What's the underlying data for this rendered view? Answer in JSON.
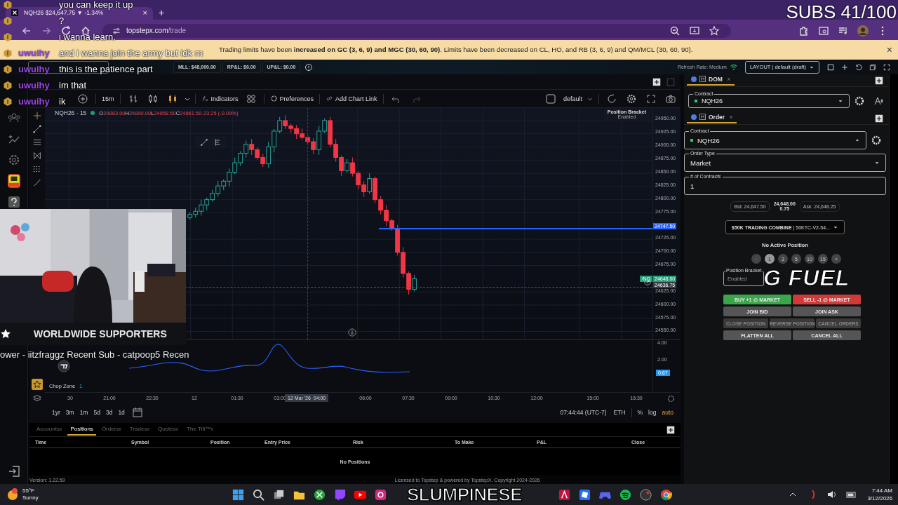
{
  "browser": {
    "tab_title": "NQH26 $24,647.75 ▼ -1.34%",
    "tab_close": "×",
    "new_tab": "+",
    "url_host": "topstepx.com",
    "url_path": "/trade"
  },
  "banner": {
    "text": "Trading limits have been **increased on GC (3, 6, 9) and MGC (30, 60, 90)**. Limits have been decreased on CL, HO, and RB (3, 6, 9) and QM/MCL (30, 60, 90).",
    "close": "×"
  },
  "app_bar": {
    "stats": [
      "MLL: $48,000.00",
      "RP&L: $0.00",
      "UP&L: $0.00"
    ],
    "refresh": "Refresh Rate: Medium",
    "layout": "LAYOUT | default (draft)"
  },
  "toolbar": {
    "interval": "15m",
    "indicators": "Indicators",
    "preferences": "Preferences",
    "chart_link": "Add Chart Link",
    "template": "default"
  },
  "legend": {
    "symbol": "NQH26 · 15",
    "ohlc": [
      {
        "label": "O",
        "value": "24883.00"
      },
      {
        "label": "H",
        "value": "24890.00"
      },
      {
        "label": "L",
        "value": "24858.50"
      },
      {
        "label": "C",
        "value": "24861.50"
      }
    ],
    "change": "-23.25 (-0.09%)"
  },
  "position_bracket_badge": {
    "title": "Position Bracket",
    "state": "Enabled"
  },
  "price_axis": [
    "24950.00",
    "24925.00",
    "24900.00",
    "24875.00",
    "24850.00",
    "24825.00",
    "24800.00",
    "24775.00",
    "24725.00",
    "24700.00",
    "24675.00",
    "24625.00",
    "24600.00",
    "24575.00",
    "24550.00"
  ],
  "price_markers": [
    {
      "kind": "line",
      "value": "24747.50",
      "color": "#2962ff"
    },
    {
      "kind": "last",
      "value": "24648.00",
      "tag": "/NQ",
      "color": "#1e9e72"
    },
    {
      "kind": "cursor",
      "value": "24636.75",
      "color": "#363a45"
    }
  ],
  "indicator": {
    "name": "Chop Zone",
    "value": "1",
    "axis": [
      "4.00",
      "2.00"
    ],
    "badge": "0.67"
  },
  "time_axis": [
    "30",
    "21:00",
    "22:30",
    "12",
    "01:30",
    "03:00",
    "06:00",
    "07:30",
    "09:00",
    "10:30",
    "12:00",
    "15:00",
    "16:30"
  ],
  "cursor_time": {
    "date": "12 Mar '26",
    "time": "04:00"
  },
  "ranges": [
    "1yr",
    "3m",
    "1m",
    "5d",
    "3d",
    "1d"
  ],
  "clock": "07:44:44 (UTC-7)",
  "session": "ETH",
  "scale_options": [
    "%",
    "log",
    "auto"
  ],
  "bottom_tabs": [
    {
      "label": "Accounts",
      "close": "x",
      "selected": false
    },
    {
      "label": "Positions",
      "selected": true
    },
    {
      "label": "Orders",
      "close": "x",
      "selected": false
    },
    {
      "label": "Trades",
      "close": "x",
      "selected": false
    },
    {
      "label": "Quotes",
      "close": "x",
      "selected": false
    },
    {
      "label": "The Tilt™",
      "close": "x",
      "selected": false
    }
  ],
  "positions_table": {
    "columns": [
      "Time",
      "Symbol",
      "Position",
      "Entry Price",
      "Risk",
      "To Make",
      "P&L",
      "Close"
    ],
    "empty": "No Positions"
  },
  "footer": {
    "version": "Version: 1.22.59",
    "license": "Licensed to Topstep & powered by TopstepX. Copyright 2024-2026"
  },
  "dom": {
    "tab": "DOM",
    "close": "x",
    "contract_label": "Contract",
    "contract": "NQH26"
  },
  "order": {
    "tab": "Order",
    "close": "x",
    "contract_label": "Contract",
    "contract": "NQH26",
    "type_label": "Order Type",
    "type": "Market",
    "qty_label": "# of Contracts",
    "qty": "1",
    "bid": "Bid: 24,647.50",
    "mid": "24,648.00",
    "spread": "0.75",
    "ask": "Ask: 24,648.25",
    "account_name": "$50K TRADING COMBINE",
    "account_detail": "| 50KTC-V2-54...",
    "position_status": "No Active Position",
    "chips": [
      {
        "label": "-",
        "selected": false
      },
      {
        "label": "1",
        "selected": true
      },
      {
        "label": "3",
        "selected": false
      },
      {
        "label": "5",
        "selected": false
      },
      {
        "label": "10",
        "selected": false
      },
      {
        "label": "15",
        "selected": false
      },
      {
        "label": "+",
        "selected": false
      }
    ],
    "bracket_label": "Position Bracket",
    "bracket": "Enabled",
    "buttons": [
      {
        "label": "BUY +1 @ MARKET",
        "kind": "buy",
        "disabled": false
      },
      {
        "label": "SELL -1 @ MARKET",
        "kind": "sell",
        "disabled": false
      },
      {
        "label": "JOIN BID",
        "kind": "plain",
        "disabled": false
      },
      {
        "label": "JOIN ASK",
        "kind": "plain",
        "disabled": false
      },
      {
        "label": "CLOSE POSITION",
        "kind": "plain",
        "disabled": true
      },
      {
        "label": "REVERSE POSITION",
        "kind": "plain",
        "disabled": true
      },
      {
        "label": "CANCEL ORDERS",
        "kind": "plain",
        "disabled": true
      },
      {
        "label": "FLATTEN ALL",
        "kind": "plain",
        "disabled": false
      },
      {
        "label": "CANCEL ALL",
        "kind": "plain",
        "disabled": false
      }
    ]
  },
  "taskbar": {
    "temperature": "55°F",
    "weather": "Sunny",
    "time": "7:44 AM",
    "date": "3/12/2026"
  },
  "stream_overlay": {
    "chat": [
      {
        "message": "you can keep it up"
      },
      {
        "message": "?"
      },
      {
        "message": "i wanna learn."
      },
      {
        "user": "uwuihy",
        "message": "and i wanna join the army but idk rn"
      },
      {
        "user": "uwuihy",
        "message": "this is the patience part"
      },
      {
        "user": "uwuihy",
        "message": "im that"
      },
      {
        "user": "uwuihy",
        "message": "ik"
      }
    ],
    "subs": "SUBS 41/100",
    "sponsor": "G FUEL",
    "supporters": "WORLDWIDE SUPPORTERS",
    "ticker": "ower - iitzfraggz  Recent Sub - catpoop5   Recen",
    "channel": "SLUMPINESE"
  }
}
